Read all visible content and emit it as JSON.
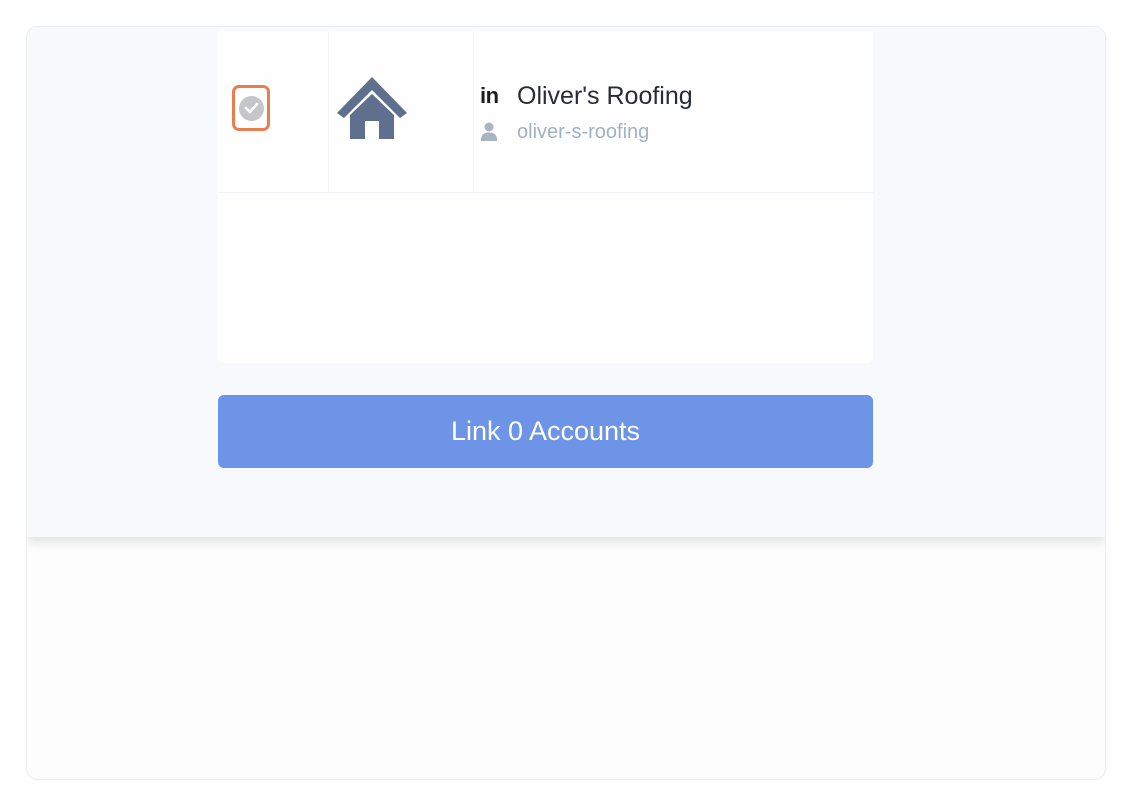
{
  "colors": {
    "accent_button": "#6d94e6",
    "checkbox_border": "#e87d4f",
    "house_icon": "#5f6f8e",
    "handle_text": "#a4b1c4"
  },
  "accounts": [
    {
      "platform_icon": "linkedin-icon",
      "platform_glyph": "in",
      "avatar_icon": "house-icon",
      "name": "Oliver's Roofing",
      "handle_icon": "user-icon",
      "handle": "oliver-s-roofing",
      "checkbox_icon": "check-circle-icon"
    }
  ],
  "actions": {
    "link_label": "Link 0 Accounts"
  }
}
